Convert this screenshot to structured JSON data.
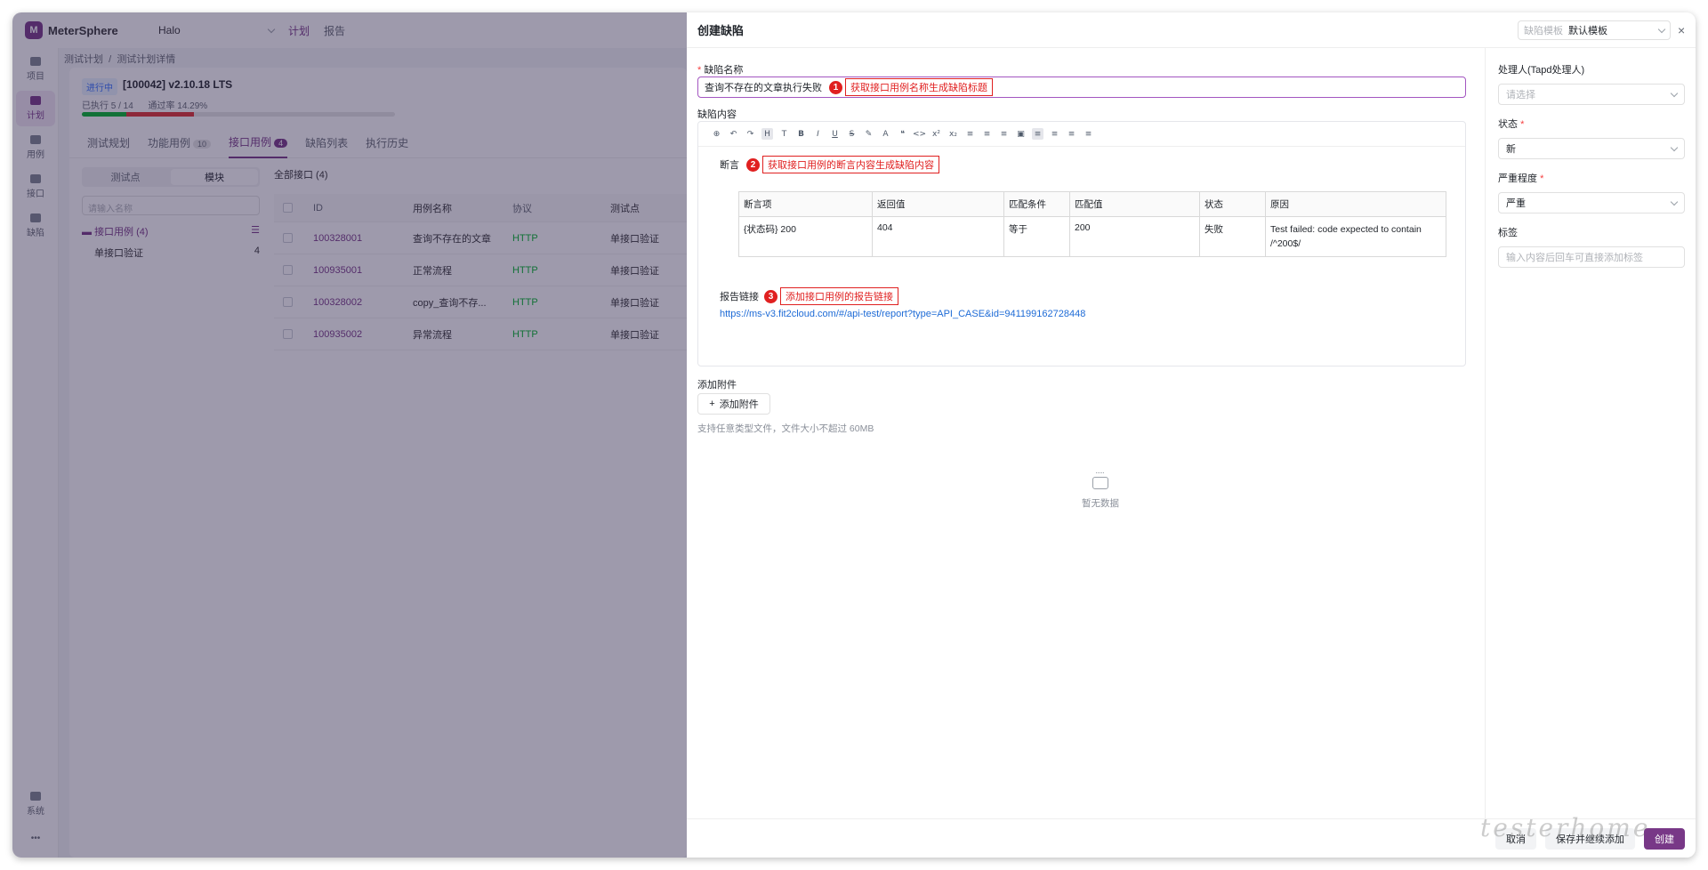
{
  "app": {
    "brand": "MeterSphere",
    "project": "Halo",
    "nav_tabs": [
      "计划",
      "报告"
    ]
  },
  "left_nav": [
    {
      "label": "项目",
      "active": false
    },
    {
      "label": "计划",
      "active": true
    },
    {
      "label": "用例",
      "active": false
    },
    {
      "label": "接口",
      "active": false
    },
    {
      "label": "缺陷",
      "active": false
    }
  ],
  "left_nav_bottom": {
    "system": "系统",
    "more": "•••"
  },
  "breadcrumb": {
    "first": "测试计划",
    "sep": "/",
    "second": "测试计划详情"
  },
  "plan": {
    "status": "进行中",
    "title": "[100042] v2.10.18 LTS",
    "executed_label": "已执行",
    "executed_value": "5 / 14",
    "pass_label": "通过率",
    "pass_value": "14.29%",
    "progress": {
      "passed": 0.143,
      "failed": 0.214,
      "color_passed": "#00b42a",
      "color_failed": "#e03131"
    },
    "tabs": [
      {
        "label": "测试规划",
        "count": "",
        "active": false
      },
      {
        "label": "功能用例",
        "count": "10",
        "active": false
      },
      {
        "label": "接口用例",
        "count": "4",
        "active": true
      },
      {
        "label": "缺陷列表",
        "count": "",
        "active": false
      },
      {
        "label": "执行历史",
        "count": "",
        "active": false
      }
    ]
  },
  "module_panel": {
    "seg": [
      "测试点",
      "模块"
    ],
    "search_placeholder": "请输入名称",
    "root": "接口用例 (4)",
    "child": "单接口验证",
    "child_count": "4"
  },
  "case_table": {
    "title": "全部接口 (4)",
    "headers": [
      "ID",
      "用例名称",
      "协议",
      "测试点"
    ],
    "rows": [
      {
        "id": "100328001",
        "name": "查询不存在的文章",
        "protocol": "HTTP",
        "point": "单接口验证"
      },
      {
        "id": "100935001",
        "name": "正常流程",
        "protocol": "HTTP",
        "point": "单接口验证"
      },
      {
        "id": "100328002",
        "name": "copy_查询不存...",
        "protocol": "HTTP",
        "point": "单接口验证"
      },
      {
        "id": "100935002",
        "name": "异常流程",
        "protocol": "HTTP",
        "point": "单接口验证"
      }
    ]
  },
  "drawer": {
    "title": "创建缺陷",
    "template_label": "缺陷模板",
    "template_value": "默认模板",
    "close": "×",
    "name_label": "缺陷名称",
    "name_value": "查询不存在的文章执行失败",
    "content_label": "缺陷内容",
    "toolbar": [
      "⊕",
      "↶",
      "↷",
      "H",
      "T",
      "B",
      "I",
      "U",
      "S",
      "✎",
      "A",
      "❝",
      "<>",
      "x²",
      "x₂",
      "≡",
      "≡",
      "≡",
      "▣",
      "≡",
      "≡",
      "≡",
      "≡"
    ],
    "assert_label": "断言",
    "assert_headers": [
      "断言项",
      "返回值",
      "匹配条件",
      "匹配值",
      "状态",
      "原因"
    ],
    "assert_rows": [
      {
        "item": "{状态码} 200",
        "ret": "404",
        "cond": "等于",
        "match": "200",
        "status": "失败",
        "reason": "Test failed: code expected to contain /^200$/"
      }
    ],
    "report_label": "报告链接",
    "report_url": "https://ms-v3.fit2cloud.com/#/api-test/report?type=API_CASE&id=941199162728448",
    "attach_label": "添加附件",
    "attach_button": "添加附件",
    "attach_hint": "支持任意类型文件，文件大小不超过 60MB",
    "empty_text": "暂无数据",
    "side": {
      "handler_label": "处理人(Tapd处理人)",
      "handler_placeholder": "请选择",
      "status_label": "状态",
      "status_value": "新",
      "severity_label": "严重程度",
      "severity_value": "严重",
      "tag_label": "标签",
      "tag_placeholder": "输入内容后回车可直接添加标签"
    },
    "footer": {
      "cancel": "取消",
      "save_continue": "保存并继续添加",
      "create": "创建"
    }
  },
  "callouts": [
    {
      "num": "1",
      "text": "获取接口用例名称生成缺陷标题"
    },
    {
      "num": "2",
      "text": "获取接口用例的断言内容生成缺陷内容"
    },
    {
      "num": "3",
      "text": "添加接口用例的报告链接"
    }
  ],
  "watermark": "testerhome"
}
